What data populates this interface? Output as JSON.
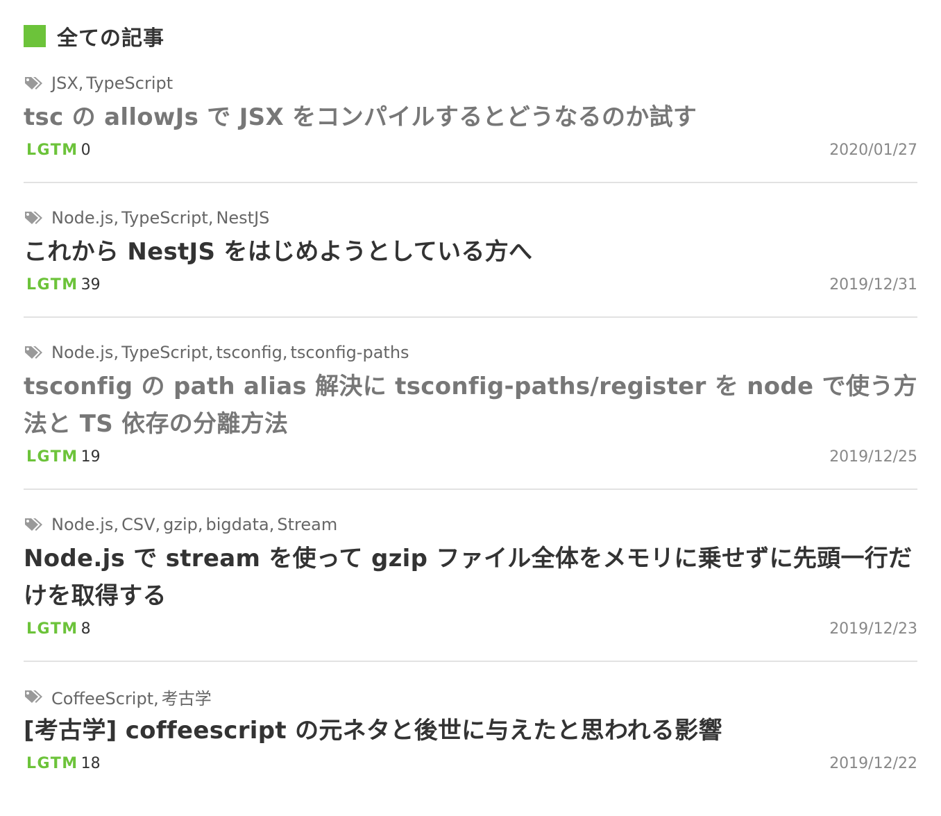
{
  "section": {
    "title": "全ての記事",
    "mark_color": "#6cc33a"
  },
  "icons": {
    "tag": "tags-icon"
  },
  "lgtm_label": "LGTM",
  "articles": [
    {
      "tags": [
        "JSX",
        "TypeScript"
      ],
      "title": "tsc の allowJs で JSX をコンパイルするとどうなるのか試す",
      "title_style": "gray",
      "lgtm": "0",
      "date": "2020/01/27"
    },
    {
      "tags": [
        "Node.js",
        "TypeScript",
        "NestJS"
      ],
      "title": "これから NestJS をはじめようとしている方へ",
      "title_style": "dark",
      "lgtm": "39",
      "date": "2019/12/31"
    },
    {
      "tags": [
        "Node.js",
        "TypeScript",
        "tsconfig",
        "tsconfig-paths"
      ],
      "title": "tsconfig の path alias 解決に tsconfig-paths/register を node で使う方法と TS 依存の分離方法",
      "title_style": "gray",
      "lgtm": "19",
      "date": "2019/12/25"
    },
    {
      "tags": [
        "Node.js",
        "CSV",
        "gzip",
        "bigdata",
        "Stream"
      ],
      "title": "Node.js で stream を使って gzip ファイル全体をメモリに乗せずに先頭一行だけを取得する",
      "title_style": "dark",
      "lgtm": "8",
      "date": "2019/12/23"
    },
    {
      "tags": [
        "CoffeeScript",
        "考古学"
      ],
      "title": "[考古学] coffeescript の元ネタと後世に与えたと思われる影響",
      "title_style": "dark",
      "lgtm": "18",
      "date": "2019/12/22"
    }
  ]
}
